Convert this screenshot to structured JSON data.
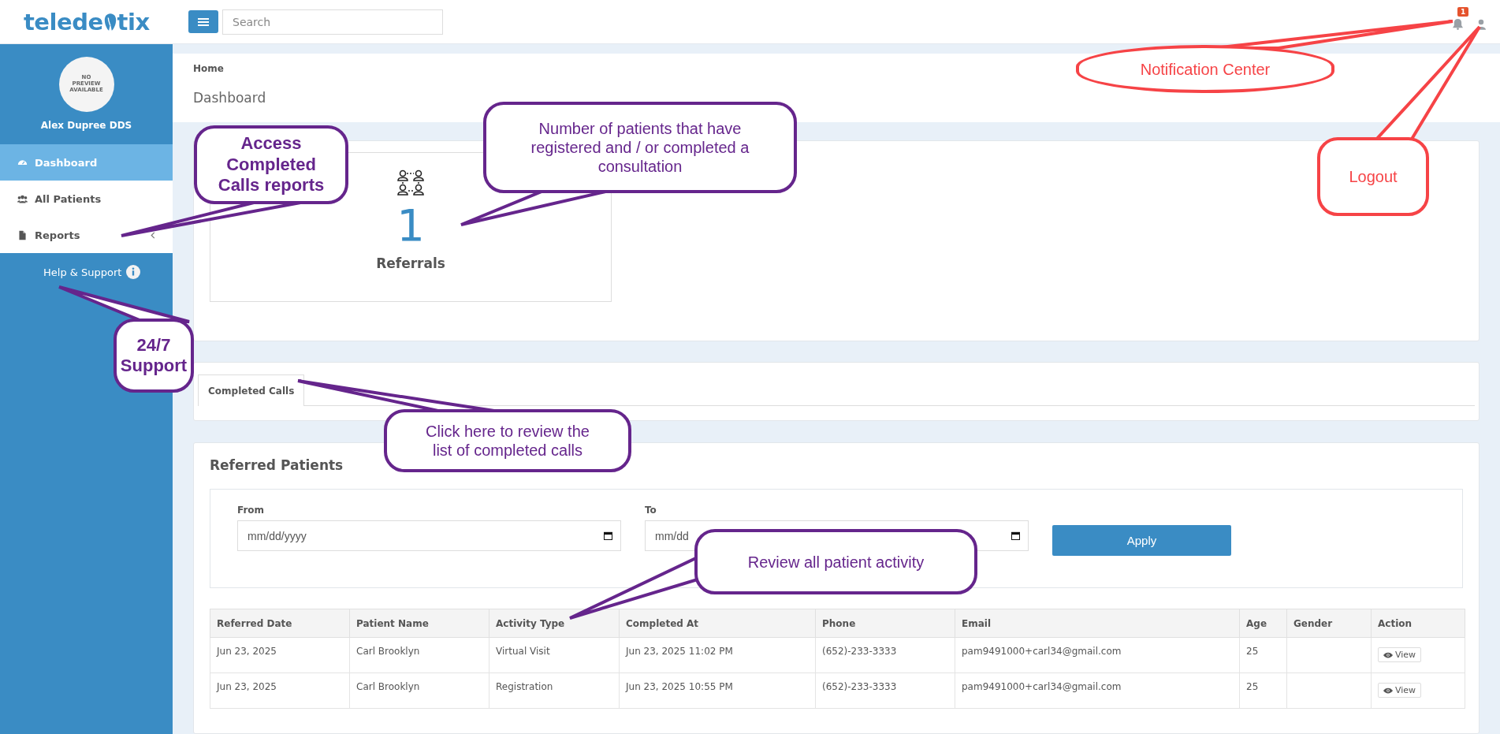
{
  "header": {
    "logo_start": "telede",
    "logo_end": "tix",
    "search": {
      "placeholder": "Search"
    },
    "notification_badge": "1"
  },
  "sidebar": {
    "avatar_text": "NO PREVIEW AVAILABLE",
    "user_name": "Alex Dupree DDS",
    "items": [
      {
        "label": "Dashboard",
        "selected": true,
        "expandable": false
      },
      {
        "label": "All Patients",
        "selected": false,
        "expandable": false
      },
      {
        "label": "Reports",
        "selected": false,
        "expandable": true
      }
    ],
    "help": "Help & Support"
  },
  "breadcrumb": "Home",
  "page_title": "Dashboard",
  "stats": [
    {
      "value": "1",
      "label": "Referrals"
    }
  ],
  "tabs": [
    {
      "label": "Completed Calls",
      "selected": true
    }
  ],
  "referred_patients": {
    "title": "Referred Patients",
    "filters": [
      {
        "label": "From",
        "placeholder": "mm/dd/yyyy"
      },
      {
        "label": "To",
        "placeholder": "mm/dd"
      }
    ],
    "apply": "Apply",
    "table": {
      "columns": [
        "Referred Date",
        "Patient Name",
        "Activity Type",
        "Completed At",
        "Phone",
        "Email",
        "Age",
        "Gender",
        "Action"
      ],
      "rows": [
        {
          "cells": [
            "Jun 23, 2025",
            "Carl Brooklyn",
            "Virtual Visit",
            "Jun 23, 2025 11:02 PM",
            "(652)-233-3333",
            "pam9491000+carl34@gmail.com",
            "25",
            ""
          ],
          "action": "View"
        },
        {
          "cells": [
            "Jun 23, 2025",
            "Carl Brooklyn",
            "Registration",
            "Jun 23, 2025 10:55 PM",
            "(652)-233-3333",
            "pam9491000+carl34@gmail.com",
            "25",
            ""
          ],
          "action": "View"
        }
      ]
    }
  },
  "annotations": [
    {
      "text": "Access Completed Calls reports",
      "kind": "bold",
      "color": "#65258c"
    },
    {
      "text": "Number of patients that have registered and / or completed a consultation",
      "kind": "plain",
      "color": "#65258c"
    },
    {
      "text": "24/7 Support",
      "kind": "bold",
      "color": "#65258c"
    },
    {
      "text": "Click here to review the list of completed calls",
      "kind": "plain",
      "color": "#65258c"
    },
    {
      "text": "Review all patient activity",
      "kind": "plain",
      "color": "#65258c"
    },
    {
      "text": "Notification Center",
      "kind": "plain",
      "color": "#f64346"
    },
    {
      "text": "Logout",
      "kind": "plain",
      "color": "#f64346"
    }
  ]
}
